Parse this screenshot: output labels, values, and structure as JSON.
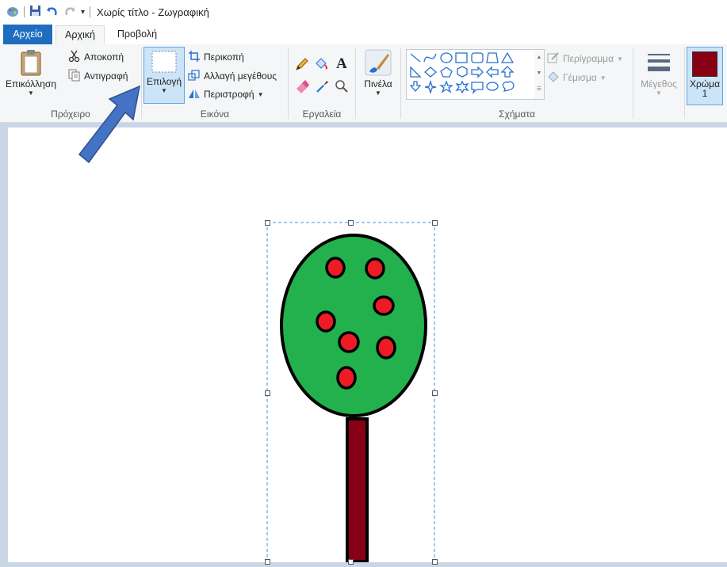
{
  "titlebar": {
    "title": "Χωρίς τίτλο - Ζωγραφική"
  },
  "tabs": {
    "file": "Αρχείο",
    "home": "Αρχική",
    "view": "Προβολή"
  },
  "clipboard": {
    "paste": "Επικόλληση",
    "cut": "Αποκοπή",
    "copy": "Αντιγραφή",
    "label": "Πρόχειρο"
  },
  "image": {
    "select": "Επιλογή",
    "crop": "Περικοπή",
    "resize": "Αλλαγή μεγέθους",
    "rotate": "Περιστροφή",
    "label": "Εικόνα"
  },
  "tools": {
    "label": "Εργαλεία",
    "text_glyph": "A"
  },
  "brushes": {
    "label": "Πινέλα"
  },
  "shapes": {
    "label": "Σχήματα",
    "outline": "Περίγραμμα",
    "fill": "Γέμισμα"
  },
  "size": {
    "label": "Μέγεθος"
  },
  "color1": {
    "label": "Χρώμα",
    "index": "1",
    "value": "#880015"
  },
  "colors": {
    "accent": "#1f6dc0",
    "tree_crown": "#22b14c",
    "fruit": "#ed1c24",
    "trunk": "#880015",
    "arrow": "#4472c4"
  }
}
